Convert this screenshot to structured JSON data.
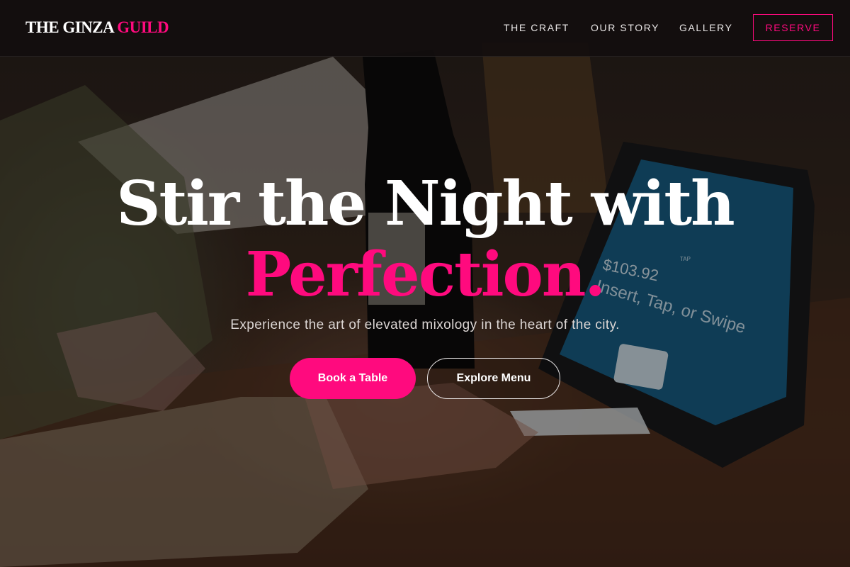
{
  "brand": {
    "name_part1": "THE GINZA",
    "name_part2": "GUILD",
    "accent_color": "#ff0a7e"
  },
  "nav": {
    "items": [
      {
        "label": "THE CRAFT"
      },
      {
        "label": "OUR STORY"
      },
      {
        "label": "GALLERY"
      }
    ],
    "cta_label": "RESERVE"
  },
  "hero": {
    "title_line1": "Stir the Night with",
    "title_line2": "Perfection.",
    "subtitle": "Experience the art of elevated mixology in the heart of the city.",
    "primary_button": "Book a Table",
    "secondary_button": "Explore Menu",
    "background_image": {
      "description_icon": "photo-background",
      "terminal_amount": "$103.92",
      "terminal_prompt": "Insert, Tap, or Swipe",
      "terminal_tap": "TAP"
    }
  }
}
